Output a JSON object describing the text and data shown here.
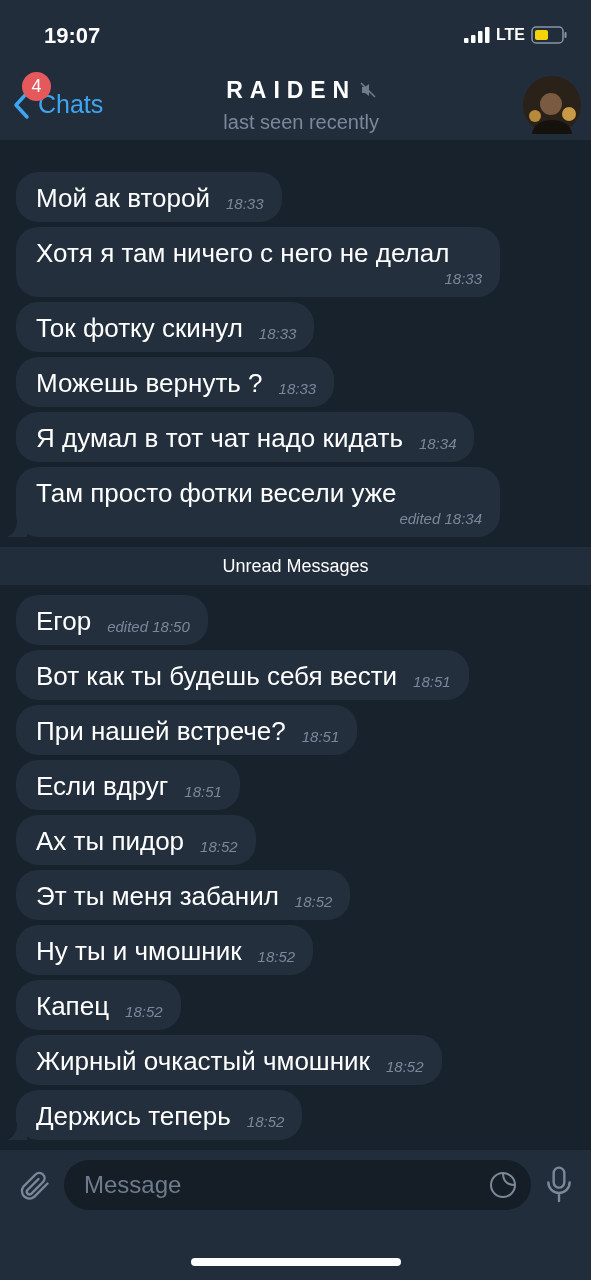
{
  "status_bar": {
    "time": "19:07",
    "network": "LTE"
  },
  "header": {
    "back_label": "Chats",
    "unread_badge": "4",
    "title": "RAIDEN",
    "muted": true,
    "subtitle": "last seen recently"
  },
  "messages_before": [
    {
      "text": "Мой ак второй",
      "time": "18:33"
    },
    {
      "text": "Хотя я там ничего с него не делал",
      "time": "18:33"
    },
    {
      "text": "Ток фотку скинул",
      "time": "18:33"
    },
    {
      "text": "Можешь вернуть ?",
      "time": "18:33"
    },
    {
      "text": "Я думал в тот чат надо кидать",
      "time": "18:34"
    },
    {
      "text": "Там просто фотки весели уже",
      "time": "edited 18:34"
    }
  ],
  "unread_divider": "Unread Messages",
  "messages_after": [
    {
      "text": "Егор",
      "time": "edited 18:50"
    },
    {
      "text": "Вот как ты будешь себя вести",
      "time": "18:51"
    },
    {
      "text": "При нашей встрече?",
      "time": "18:51"
    },
    {
      "text": "Если вдруг",
      "time": "18:51"
    },
    {
      "text": "Ах ты пидор",
      "time": "18:52"
    },
    {
      "text": "Эт ты меня забанил",
      "time": "18:52"
    },
    {
      "text": "Ну ты и чмошник",
      "time": "18:52"
    },
    {
      "text": "Капец",
      "time": "18:52"
    },
    {
      "text": "Жирный очкастый чмошник",
      "time": "18:52"
    },
    {
      "text": "Держись теперь",
      "time": "18:52"
    }
  ],
  "composer": {
    "placeholder": "Message"
  }
}
